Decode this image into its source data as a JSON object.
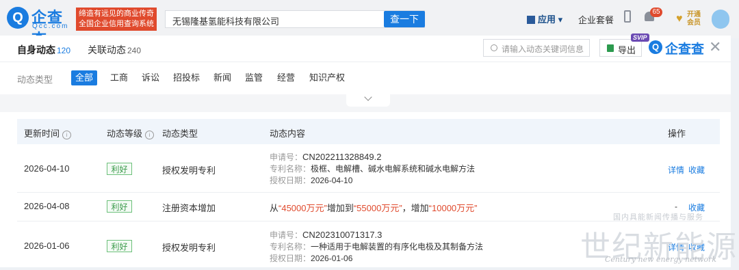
{
  "header": {
    "logo_cn": "企查查",
    "logo_en": "Qcc.com",
    "slogan_line1": "缔造有远见的商业传奇",
    "slogan_line2": "全国企业信用查询系统",
    "search_value": "无锡隆基氢能科技有限公司",
    "search_button": "查一下",
    "app_menu": "应用",
    "package": "企业套餐",
    "notification_count": "65",
    "vip_label": "开通会员"
  },
  "tabs": {
    "main_label": "自身动态",
    "main_count": "120",
    "related_label": "关联动态",
    "related_count": "240",
    "keyword_placeholder": "请输入动态关键词信息",
    "export_label": "导出",
    "svip_badge": "SVIP",
    "brand": "企查查"
  },
  "filter": {
    "label": "动态类型",
    "chips": [
      "全部",
      "工商",
      "诉讼",
      "招投标",
      "新闻",
      "监管",
      "经营",
      "知识产权"
    ],
    "active_index": 0
  },
  "table": {
    "headers": {
      "time": "更新时间",
      "level": "动态等级",
      "type": "动态类型",
      "content": "动态内容",
      "ops": "操作"
    },
    "rows": [
      {
        "date": "2026-04-10",
        "level": "利好",
        "type": "授权发明专利",
        "lines": [
          {
            "k": "申请号：",
            "v": "CN202211328849.2"
          },
          {
            "k": "专利名称：",
            "v": "极框、电解槽、碱水电解系统和碱水电解方法"
          },
          {
            "k": "授权日期：",
            "v": "2026-04-10"
          }
        ],
        "op1": "详情",
        "op2": "收藏"
      },
      {
        "date": "2026-04-08",
        "level": "利好",
        "type": "注册资本增加",
        "capital": {
          "p1": "从",
          "from": "“45000万元”",
          "p2": "增加到",
          "to": "“55000万元”",
          "p3": "，增加",
          "inc": "“10000万元”"
        },
        "op1": "-",
        "op2": "收藏"
      },
      {
        "date": "2026-01-06",
        "level": "利好",
        "type": "授权发明专利",
        "lines": [
          {
            "k": "申请号：",
            "v": "CN202310071317.3"
          },
          {
            "k": "专利名称：",
            "v": "一种适用于电解装置的有序化电极及其制备方法"
          },
          {
            "k": "授权日期：",
            "v": "2026-01-06"
          }
        ],
        "op1": "详情",
        "op2": "收藏"
      }
    ]
  },
  "watermark": {
    "small": "国内具能新闻传播与服务",
    "big": "世纪新能源网",
    "en": "Century new energy network"
  },
  "colors": {
    "accent": "#1a7ce0",
    "positive": "#3a9a4a",
    "highlight": "#e04a2d"
  }
}
